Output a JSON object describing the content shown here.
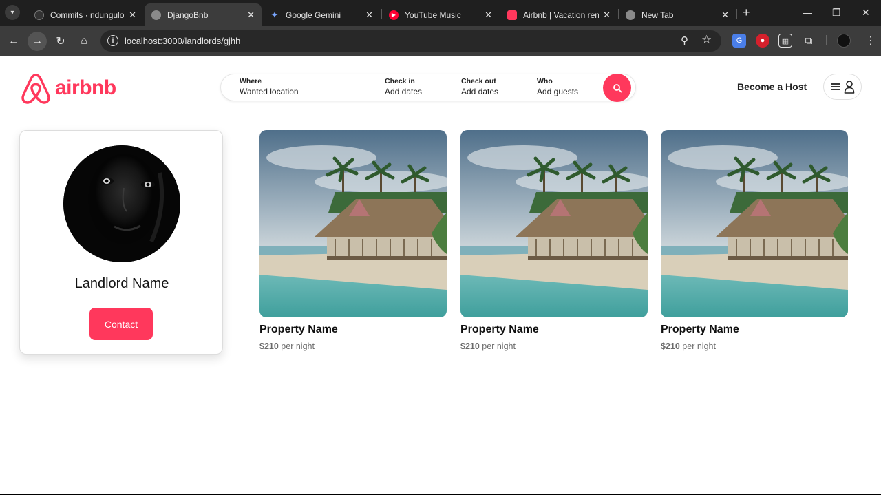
{
  "browser": {
    "tabs": [
      {
        "title": "Commits · ndungulon",
        "active": false,
        "favicon": "github-icon"
      },
      {
        "title": "DjangoBnb",
        "active": true,
        "favicon": "globe-icon"
      },
      {
        "title": "Google Gemini",
        "active": false,
        "favicon": "gemini-icon"
      },
      {
        "title": "YouTube Music",
        "active": false,
        "favicon": "youtube-music-icon"
      },
      {
        "title": "Airbnb | Vacation ren",
        "active": false,
        "favicon": "airbnb-icon"
      },
      {
        "title": "New Tab",
        "active": false,
        "favicon": "chrome-icon"
      }
    ],
    "url": "localhost:3000/landlords/gjhh"
  },
  "header": {
    "logo_text": "airbnb",
    "search": {
      "where_label": "Where",
      "where_value": "Wanted location",
      "checkin_label": "Check in",
      "checkin_value": "Add dates",
      "checkout_label": "Check out",
      "checkout_value": "Add dates",
      "who_label": "Who",
      "who_value": "Add guests"
    },
    "host_link": "Become a Host"
  },
  "landlord": {
    "name": "Landlord Name",
    "contact_label": "Contact"
  },
  "properties": [
    {
      "name": "Property Name",
      "price": "$210",
      "unit": "per night"
    },
    {
      "name": "Property Name",
      "price": "$210",
      "unit": "per night"
    },
    {
      "name": "Property Name",
      "price": "$210",
      "unit": "per night"
    }
  ],
  "colors": {
    "brand": "#ff385c",
    "tab_bg": "#1f1f1f",
    "toolbar_bg": "#3c3c3c"
  }
}
